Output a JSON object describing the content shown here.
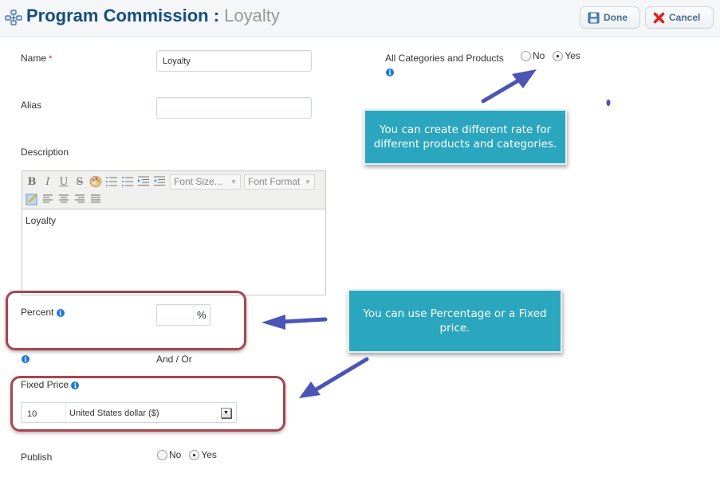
{
  "header": {
    "title": "Program Commission :",
    "subtitle": "Loyalty",
    "icon": "network-icon",
    "buttons": [
      {
        "label": "Done",
        "icon": "save-icon"
      },
      {
        "label": "Cancel",
        "icon": "cancel-x-icon"
      }
    ]
  },
  "form": {
    "name": {
      "label": "Name",
      "required_mark": "*",
      "value": "Loyalty"
    },
    "alias": {
      "label": "Alias",
      "value": ""
    },
    "description": {
      "label": "Description",
      "toolbar": {
        "row1": [
          "bold",
          "italic",
          "underline",
          "strikethrough",
          "color-palette",
          "ordered-list",
          "unordered-list",
          "indent",
          "outdent"
        ],
        "font_size_placeholder": "Font Size...",
        "font_format_placeholder": "Font Format",
        "row2": [
          "edit",
          "align-left",
          "align-center",
          "align-right",
          "justify"
        ]
      },
      "glyphs": {
        "bold": "B",
        "italic": "I",
        "underline": "U",
        "strikethrough": "S"
      },
      "content": "Loyalty"
    },
    "all_categories": {
      "label": "All Categories and Products",
      "options": [
        {
          "label": "No",
          "selected": false
        },
        {
          "label": "Yes",
          "selected": true
        }
      ]
    },
    "percent": {
      "label": "Percent",
      "value": "",
      "suffix": "%"
    },
    "and_or": "And / Or",
    "fixed_price": {
      "label": "Fixed Price",
      "value": "10",
      "currency": "United States dollar ($)"
    },
    "publish": {
      "label": "Publish",
      "options": [
        {
          "label": "No",
          "selected": false
        },
        {
          "label": "Yes",
          "selected": true
        }
      ]
    }
  },
  "annotations": {
    "callout_categories": "You can create different rate for different products and categories.",
    "callout_price": "You can use Percentage or a Fixed price.",
    "callout_color": "#2ba6bf",
    "highlight_color": "#a8454f",
    "arrow_color": "#4a55b5"
  }
}
